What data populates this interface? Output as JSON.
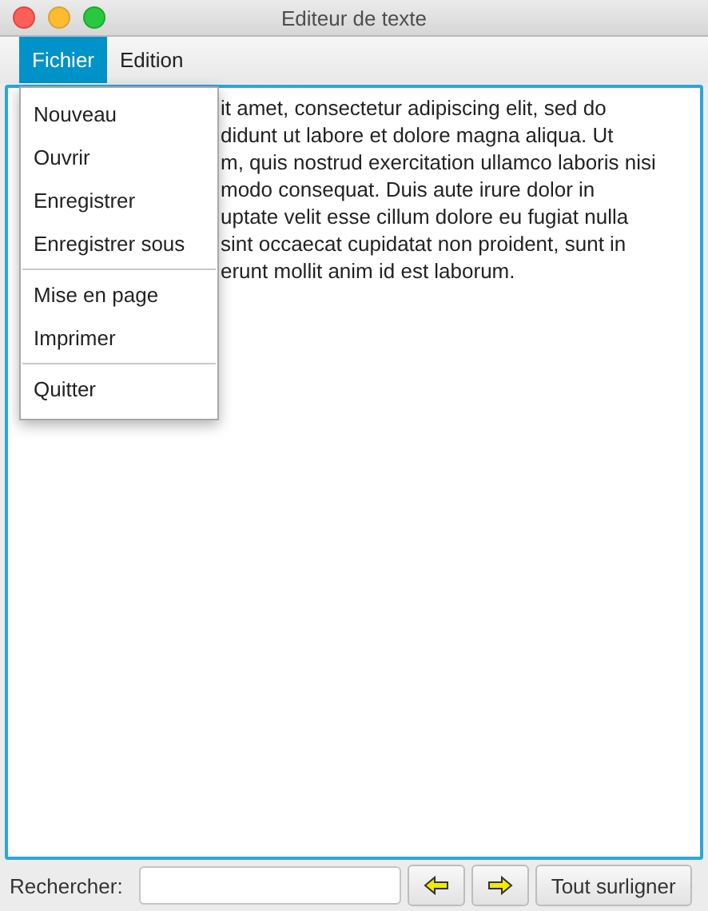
{
  "window": {
    "title": "Editeur de texte"
  },
  "menubar": [
    {
      "label": "Fichier",
      "selected": true
    },
    {
      "label": "Edition",
      "selected": false
    }
  ],
  "menu": {
    "groups": [
      [
        "Nouveau",
        "Ouvrir",
        "Enregistrer",
        "Enregistrer sous"
      ],
      [
        "Mise en page",
        "Imprimer"
      ],
      [
        "Quitter"
      ]
    ]
  },
  "editor": {
    "lines": [
      "it amet, consectetur adipiscing elit, sed do",
      "didunt ut labore et dolore magna aliqua. Ut",
      "m, quis nostrud exercitation ullamco laboris nisi",
      "modo consequat. Duis aute irure dolor in",
      "uptate velit esse cillum dolore eu fugiat nulla",
      "sint occaecat cupidatat non proident, sunt in",
      "erunt mollit anim id est laborum."
    ]
  },
  "search": {
    "label": "Rechercher:",
    "button": "Tout surligner"
  }
}
